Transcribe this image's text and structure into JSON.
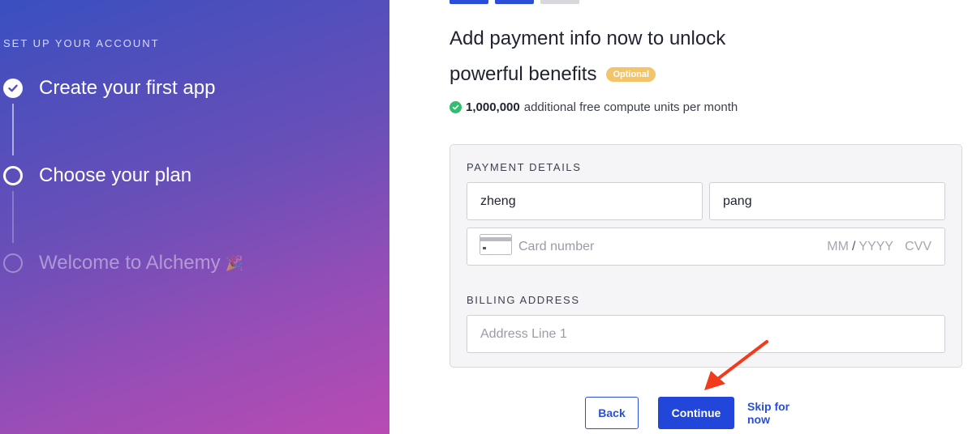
{
  "sidebar": {
    "kicker": "SET UP YOUR ACCOUNT",
    "steps": [
      {
        "label": "Create your first app",
        "state": "done"
      },
      {
        "label": "Choose your plan",
        "state": "current"
      },
      {
        "label": "Welcome to Alchemy",
        "state": "todo",
        "emoji": "🎉"
      }
    ]
  },
  "progress": {
    "completed": 2,
    "total": 3
  },
  "main": {
    "heading_line1": "Add payment info now to unlock",
    "heading_line2": "powerful benefits",
    "badge": "Optional",
    "benefit_amount": "1,000,000",
    "benefit_text": "additional free compute units per month"
  },
  "payment": {
    "section_label": "PAYMENT DETAILS",
    "first_name": "zheng",
    "last_name": "pang",
    "card_placeholder": "Card number",
    "mm": "MM",
    "slash": "/",
    "yyyy": "YYYY",
    "cvv": "CVV"
  },
  "billing": {
    "section_label": "BILLING ADDRESS",
    "address_placeholder": "Address Line 1"
  },
  "actions": {
    "back": "Back",
    "continue": "Continue",
    "skip": "Skip for now"
  },
  "colors": {
    "accent": "#2146d9",
    "badge": "#f2c56a",
    "success": "#2ebf6e",
    "annotation_arrow": "#f23a1d"
  }
}
